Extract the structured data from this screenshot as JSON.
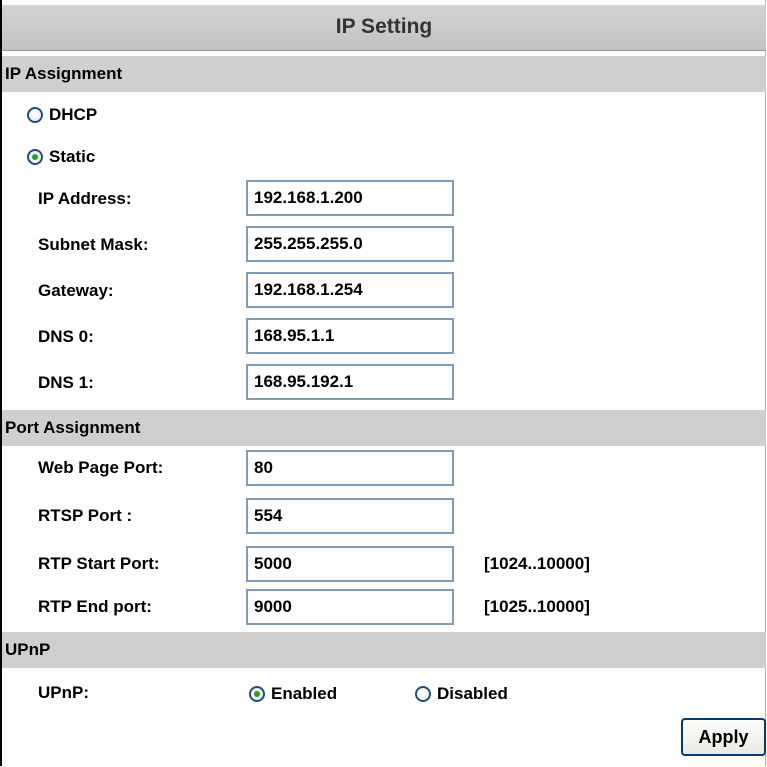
{
  "title": "IP Setting",
  "ip_assignment": {
    "heading": "IP Assignment",
    "dhcp_label": "DHCP",
    "static_label": "Static",
    "selected": "Static",
    "fields": {
      "ip_address": {
        "label": "IP Address:",
        "value": "192.168.1.200"
      },
      "subnet_mask": {
        "label": "Subnet Mask:",
        "value": "255.255.255.0"
      },
      "gateway": {
        "label": "Gateway:",
        "value": "192.168.1.254"
      },
      "dns0": {
        "label": "DNS 0:",
        "value": "168.95.1.1"
      },
      "dns1": {
        "label": "DNS 1:",
        "value": "168.95.192.1"
      }
    }
  },
  "port_assignment": {
    "heading": "Port Assignment",
    "fields": {
      "web_port": {
        "label": "Web Page Port:",
        "value": "80"
      },
      "rtsp_port": {
        "label": "RTSP Port :",
        "value": "554"
      },
      "rtp_start": {
        "label": "RTP Start Port:",
        "value": "5000",
        "range": "[1024..10000]"
      },
      "rtp_end": {
        "label": "RTP End port:",
        "value": "9000",
        "range": "[1025..10000]"
      }
    }
  },
  "upnp": {
    "heading": "UPnP",
    "label": "UPnP:",
    "enabled_label": "Enabled",
    "disabled_label": "Disabled",
    "selected": "Enabled"
  },
  "apply_label": "Apply",
  "colors": {
    "header_bg": "#c8c8c8",
    "section_bg": "#cfcfcf",
    "input_border": "#7f9db9",
    "radio_dot": "#21a121"
  }
}
